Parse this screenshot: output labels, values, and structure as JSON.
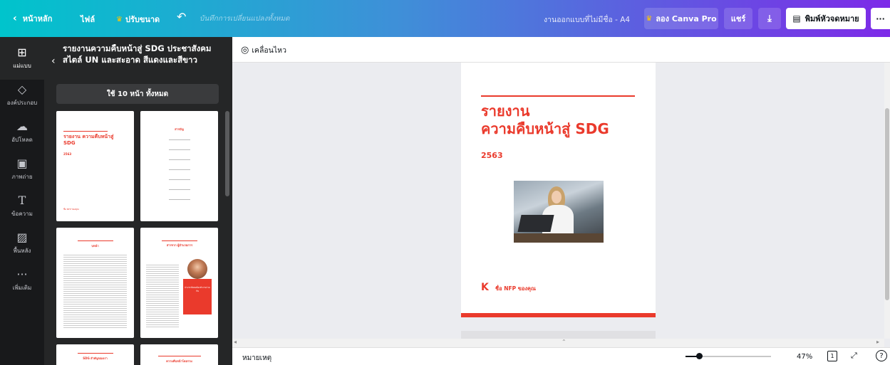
{
  "topbar": {
    "home": "หน้าหลัก",
    "file": "ไฟล์",
    "resize": "ปรับขนาด",
    "saved_status": "บันทึกการเปลี่ยนแปลงทั้งหมด",
    "design_name": "งานออกแบบที่ไม่มีชื่อ - A4",
    "try_pro": "ลอง Canva Pro",
    "share": "แชร์",
    "print_label": "พิมพ์หัวจดหมาย",
    "more": "···"
  },
  "rail": {
    "templates": "แม่แบบ",
    "elements": "องค์ประกอบ",
    "uploads": "อัปโหลด",
    "photos": "ภาพถ่าย",
    "text": "ข้อความ",
    "background": "พื้นหลัง",
    "more": "เพิ่มเติม"
  },
  "panel": {
    "title": "รายงานความคืบหน้าสู่ SDG ประชาสังคม สไตล์ UN และสะอาด สีแดงและสีขาว",
    "use_all": "ใช้ 10 หน้า ทั้งหมด",
    "thumbs": {
      "t1_title": "รายงาน ความคืบหน้าสู่ SDG",
      "t1_year": "2563",
      "t1_footer": "ชื่อ NFP ของคุณ",
      "t2_title": "สารบัญ",
      "t3_title": "บทนำ",
      "t4_title": "สารจาก ผู้อำนวยการ",
      "t4_box": "ประชาสังคมต้องทำงานร่วมกัน",
      "t5_title": "SDG สำคัญของเรา",
      "t6_title": "ความคืบหน้าโดยรวม"
    }
  },
  "canvas": {
    "animate": "เคลื่อนไหว",
    "title_line1": "รายงาน",
    "title_line2": "ความคืบหน้าสู่ SDG",
    "year": "2563",
    "org_name": "ชื่อ NFP ของคุณ",
    "logo_mark": "K"
  },
  "bottombar": {
    "notes": "หมายเหตุ",
    "zoom": "47%",
    "zoom_level": 0.47,
    "page_count": "1"
  },
  "colors": {
    "accent": "#ea3a2c",
    "dark": "#18191b",
    "panel": "#252627"
  }
}
